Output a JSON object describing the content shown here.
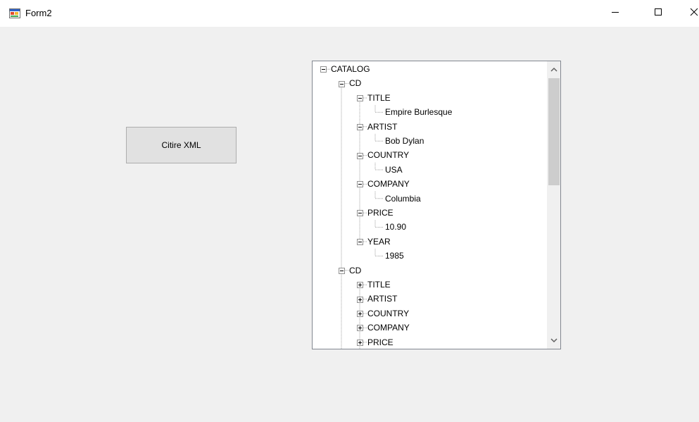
{
  "window": {
    "title": "Form2"
  },
  "button": {
    "label": "Citire XML"
  },
  "tree": {
    "rows": [
      {
        "label": "CATALOG",
        "level": 0,
        "expander": "minus"
      },
      {
        "label": "CD",
        "level": 1,
        "expander": "minus"
      },
      {
        "label": "TITLE",
        "level": 2,
        "expander": "minus"
      },
      {
        "label": "Empire Burlesque",
        "level": 3,
        "expander": "none"
      },
      {
        "label": "ARTIST",
        "level": 2,
        "expander": "minus"
      },
      {
        "label": "Bob Dylan",
        "level": 3,
        "expander": "none"
      },
      {
        "label": "COUNTRY",
        "level": 2,
        "expander": "minus"
      },
      {
        "label": "USA",
        "level": 3,
        "expander": "none"
      },
      {
        "label": "COMPANY",
        "level": 2,
        "expander": "minus"
      },
      {
        "label": "Columbia",
        "level": 3,
        "expander": "none"
      },
      {
        "label": "PRICE",
        "level": 2,
        "expander": "minus"
      },
      {
        "label": "10.90",
        "level": 3,
        "expander": "none"
      },
      {
        "label": "YEAR",
        "level": 2,
        "expander": "minus"
      },
      {
        "label": "1985",
        "level": 3,
        "expander": "none"
      },
      {
        "label": "CD",
        "level": 1,
        "expander": "minus"
      },
      {
        "label": "TITLE",
        "level": 2,
        "expander": "plus"
      },
      {
        "label": "ARTIST",
        "level": 2,
        "expander": "plus"
      },
      {
        "label": "COUNTRY",
        "level": 2,
        "expander": "plus"
      },
      {
        "label": "COMPANY",
        "level": 2,
        "expander": "plus"
      },
      {
        "label": "PRICE",
        "level": 2,
        "expander": "plus"
      }
    ]
  },
  "icons": {
    "app": "form-app-icon",
    "minimize": "minimize-icon",
    "maximize": "maximize-icon",
    "close": "close-icon",
    "scroll_up": "chevron-up-icon",
    "scroll_down": "chevron-down-icon"
  },
  "colors": {
    "window_bg": "#f0f0f0",
    "button_bg": "#e1e1e1",
    "button_border": "#adadad",
    "tree_border": "#828790",
    "scroll_thumb": "#cdcdcd"
  }
}
